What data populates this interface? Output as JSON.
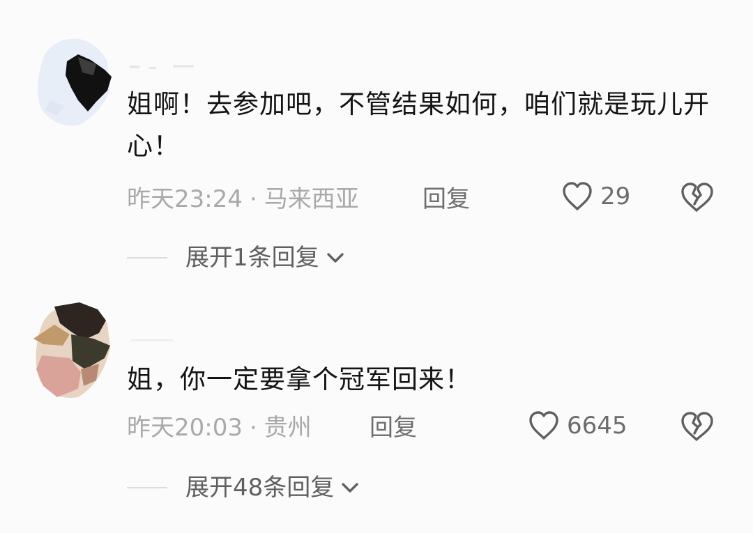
{
  "comments": [
    {
      "text": "姐啊！去参加吧，不管结果如何，咱们就是玩儿开心！",
      "time": "昨天23:24",
      "separator": "·",
      "location": "马来西亚",
      "reply_label": "回复",
      "like_count": "29",
      "expand_label": "展开1条回复"
    },
    {
      "text": "姐，你一定要拿个冠军回来！",
      "time": "昨天20:03",
      "separator": "·",
      "location": "贵州",
      "reply_label": "回复",
      "like_count": "6645",
      "expand_label": "展开48条回复"
    }
  ],
  "icons": {
    "like": "heart-outline-icon",
    "dislike": "broken-heart-icon",
    "expand": "chevron-down-icon"
  },
  "colors": {
    "background": "#fbfbfb",
    "text": "#141414",
    "meta": "#a9a9a9",
    "action": "#6e6e6e"
  }
}
